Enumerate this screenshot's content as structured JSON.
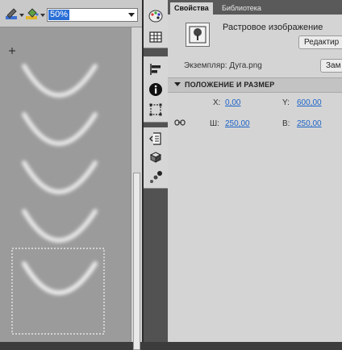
{
  "toolbar": {
    "zoom_value": "50%",
    "icons": [
      "pencil-color-icon",
      "paint-bucket-color-icon"
    ]
  },
  "stage": {
    "background": "#9b9b9b",
    "arc_count": 5
  },
  "dock": {
    "icons": [
      "color-palette-icon",
      "swatches-icon",
      "align-icon",
      "info-icon",
      "transform-icon",
      "code-snippet-icon",
      "components-icon",
      "motion-presets-icon"
    ]
  },
  "panel": {
    "tabs": [
      {
        "label": "Свойства",
        "active": true
      },
      {
        "label": "Библиотека",
        "active": false
      }
    ],
    "object_type": "Растровое изображение",
    "edit_button": "Редактир",
    "instance_label": "Экземпляр:",
    "instance_name": "Дуга.png",
    "swap_button": "Зам",
    "section_title": "ПОЛОЖЕНИЕ И РАЗМЕР",
    "position": {
      "x_label": "X:",
      "x_value": "0,00",
      "y_label": "Y:",
      "y_value": "600,00"
    },
    "size": {
      "w_label": "Ш:",
      "w_value": "250,00",
      "h_label": "В:",
      "h_value": "250,00"
    },
    "link_color": "#1d64c8"
  }
}
